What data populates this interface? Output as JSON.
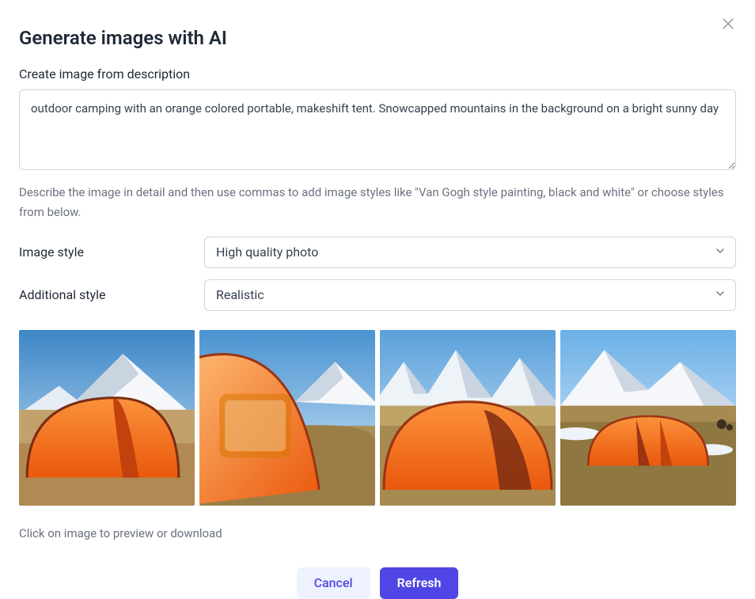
{
  "dialog": {
    "title": "Generate images with AI",
    "prompt_label": "Create image from description",
    "prompt_value": "outdoor camping with an orange colored portable, makeshift tent. Snowcapped mountains in the background on a bright sunny day",
    "prompt_helper": "Describe the image in detail and then use commas to add image styles like \"Van Gogh style painting, black and white\" or choose styles from below.",
    "image_style_label": "Image style",
    "image_style_value": "High quality photo",
    "additional_style_label": "Additional style",
    "additional_style_value": "Realistic",
    "images_helper": "Click on image to preview or download",
    "cancel_label": "Cancel",
    "refresh_label": "Refresh"
  },
  "generated_images": [
    {
      "alt": "orange tent with snowcapped mountain, bright sky"
    },
    {
      "alt": "orange tent close-up, snowy peak behind"
    },
    {
      "alt": "orange dome tent with mountain range"
    },
    {
      "alt": "wide orange tent on brown plain, snowy peak"
    }
  ],
  "colors": {
    "accent": "#4f46e5",
    "tent": "#f97316",
    "tent_shadow": "#ea580c",
    "sky_top": "#5aa7e0",
    "sky_bottom": "#cfe8fb",
    "snow": "#f5f7fa",
    "snow_shadow": "#c9d4e0",
    "ground": "#b08a52",
    "ground_dark": "#8a6c3c"
  }
}
